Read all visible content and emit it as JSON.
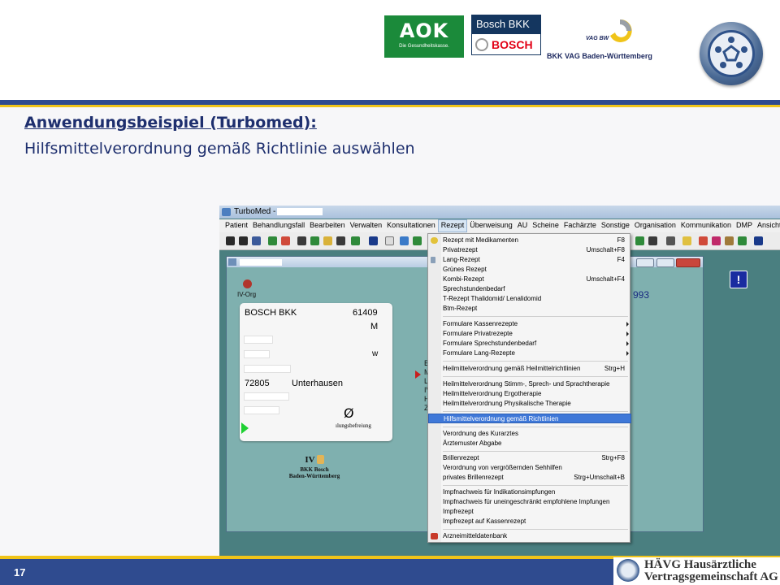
{
  "slide": {
    "title": "Anwendungsbeispiel (Turbomed):",
    "subtitle": "Hilfsmittelverordnung gemäß Richtlinie auswählen",
    "page_number": "17"
  },
  "logos": {
    "aok_text": "AOK",
    "aok_sub": "Die Gesundheitskasse.",
    "bosch_bkk": "Bosch BKK",
    "bosch": "BOSCH",
    "vag_small": "VAG BW",
    "vag_name": "BKK VAG Baden-Württemberg",
    "haevg_line1": "HÄVG Hausärztliche",
    "haevg_line2": "Vertragsgemeinschaft AG"
  },
  "app": {
    "title": "TurboMed -",
    "menubar": [
      "Patient",
      "Behandlungsfall",
      "Bearbeiten",
      "Verwalten",
      "Konsultationen",
      "Rezept",
      "Überweisung",
      "AU",
      "Scheine",
      "Fachärzte",
      "Sonstige",
      "Organisation",
      "Kommunikation",
      "DMP",
      "Ansicht",
      "?"
    ],
    "active_menu": "Rezept",
    "ivorg_label": "IV-Org",
    "card": {
      "insurer": "BOSCH BKK",
      "ik": "61409",
      "sex": "M",
      "status": "w",
      "postcode": "72805",
      "city": "Unterhausen",
      "null_symbol": "Ø",
      "befreiung": "ılungsbefreiung"
    },
    "stamp": {
      "top": "IV",
      "line2": "BKK Bosch",
      "line3": "Baden-Württemberg"
    },
    "side_letters": [
      "B",
      "M",
      "L",
      "IV",
      "H",
      "Z"
    ],
    "number_993": "993",
    "alert_symbol": "!"
  },
  "dropdown": {
    "items": [
      {
        "label": "Rezept mit Medikamenten",
        "shortcut": "F8",
        "icon_color": "#e2c23a"
      },
      {
        "label": "Privatrezept",
        "shortcut": "Umschalt+F8"
      },
      {
        "label": "Lang-Rezept",
        "shortcut": "F4",
        "icon_color": "#8aa0b8"
      },
      {
        "label": "Grünes Rezept",
        "shortcut": ""
      },
      {
        "label": "Kombi-Rezept",
        "shortcut": "Umschalt+F4"
      },
      {
        "label": "Sprechstundenbedarf",
        "shortcut": ""
      },
      {
        "label": "T-Rezept Thalidomid/ Lenalidomid",
        "shortcut": ""
      },
      {
        "label": "Btm-Rezept",
        "shortcut": ""
      },
      {
        "label": "Formulare Kassenrezepte",
        "shortcut": "",
        "submenu": true
      },
      {
        "label": "Formulare Privatrezepte",
        "shortcut": "",
        "submenu": true
      },
      {
        "label": "Formulare Sprechstundenbedarf",
        "shortcut": "",
        "submenu": true
      },
      {
        "label": "Formulare Lang-Rezepte",
        "shortcut": "",
        "submenu": true
      },
      {
        "label": "Heilmittelverordnung gemäß Heilmittelrichtlinien",
        "shortcut": "Strg+H"
      },
      {
        "label": "Heilmittelverordnung Stimm-, Sprech- und Sprachtherapie",
        "shortcut": ""
      },
      {
        "label": "Heilmittelverordnung Ergotherapie",
        "shortcut": ""
      },
      {
        "label": "Heilmittelverordnung Physikalische Therapie",
        "shortcut": ""
      },
      {
        "label": "Hilfsmittelverordnung gemäß Richtlinien",
        "shortcut": "",
        "highlighted": true
      },
      {
        "label": "Verordnung des Kurarztes",
        "shortcut": ""
      },
      {
        "label": "Ärztemuster Abgabe",
        "shortcut": ""
      },
      {
        "label": "Brillenrezept",
        "shortcut": "Strg+F8"
      },
      {
        "label": "Verordnung von vergrößernden Sehhilfen",
        "shortcut": ""
      },
      {
        "label": "privates Brillenrezept",
        "shortcut": "Strg+Umschalt+B"
      },
      {
        "label": "Impfnachweis für Indikationsimpfungen",
        "shortcut": ""
      },
      {
        "label": "Impfnachweis für uneingeschränkt empfohlene Impfungen",
        "shortcut": ""
      },
      {
        "label": "Impfrezept",
        "shortcut": ""
      },
      {
        "label": "Impfrezept auf Kassenrezept",
        "shortcut": ""
      },
      {
        "label": "Arzneimitteldatenbank",
        "shortcut": "",
        "icon_color": "#c83a2a"
      }
    ],
    "highlight_color": "#3f78d8"
  },
  "colors": {
    "brand_blue": "#2f4b8f",
    "brand_yellow": "#f0c419",
    "title_color": "#1e2f6e",
    "app_bg": "#4a7f80"
  }
}
